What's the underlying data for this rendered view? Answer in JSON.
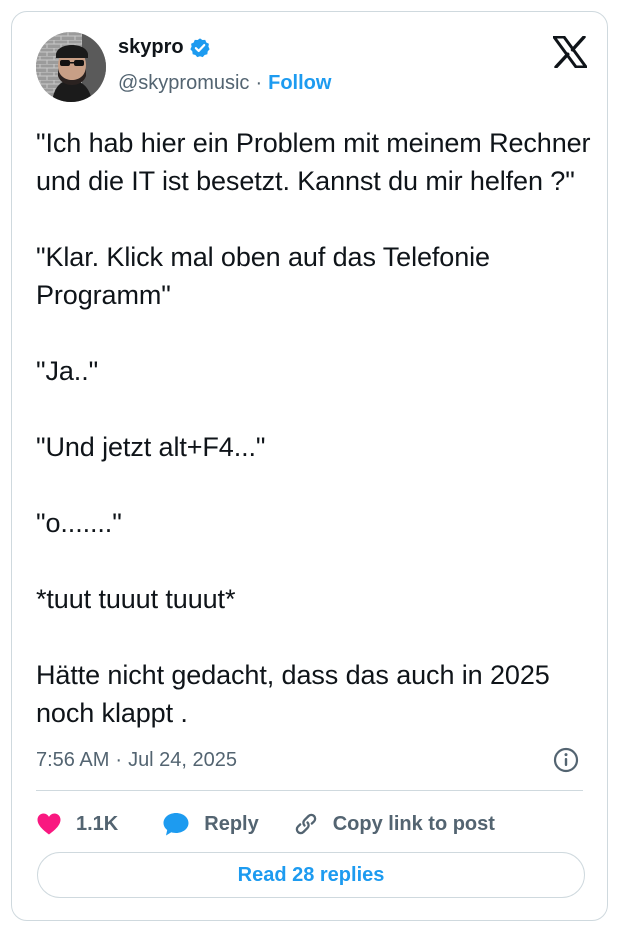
{
  "author": {
    "display_name": "skypro",
    "handle": "@skypromusic",
    "separator": "·",
    "follow_label": "Follow",
    "verified": true
  },
  "tweet": {
    "text": "\"Ich hab hier ein Problem mit meinem Rechner und die IT ist besetzt. Kannst du mir helfen ?\"\n\n\"Klar. Klick mal oben auf das Telefonie Programm\"\n\n\"Ja..\"\n\n\"Und jetzt alt+F4...\"\n\n\"o.......\"\n\n*tuut tuuut tuuut*\n\nHätte nicht gedacht, dass das auch in 2025 noch klappt ."
  },
  "meta": {
    "time": "7:56 AM",
    "separator": "·",
    "date": "Jul 24, 2025"
  },
  "actions": {
    "like_count": "1.1K",
    "reply_label": "Reply",
    "copy_label": "Copy link to post"
  },
  "read_replies_label": "Read 28 replies",
  "icons": {
    "brand": "x-logo-icon",
    "verified": "verified-badge-icon",
    "info": "info-icon",
    "like": "heart-icon",
    "reply": "speech-bubble-icon",
    "copy": "link-icon"
  },
  "colors": {
    "accent": "#1d9bf0",
    "like": "#f91880",
    "text": "#0f1419",
    "secondary": "#536471",
    "border": "#cfd9de"
  }
}
